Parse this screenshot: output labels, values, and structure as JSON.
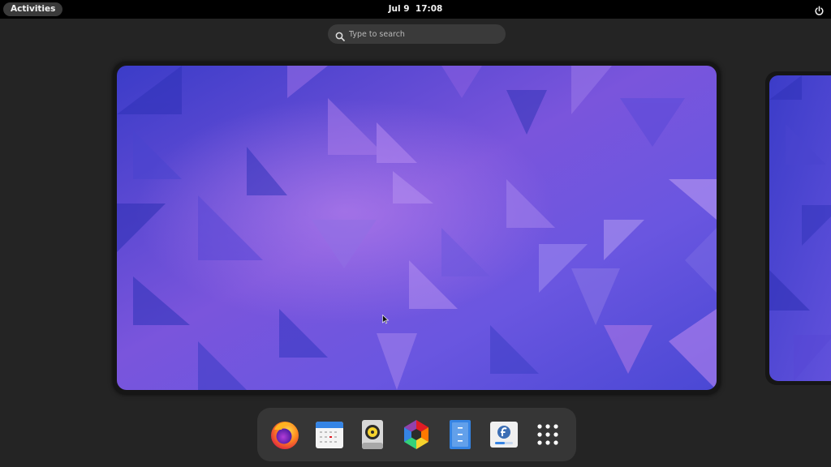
{
  "topbar": {
    "activities_label": "Activities",
    "date": "Jul 9",
    "time": "17:08",
    "power_icon": "power-icon"
  },
  "search": {
    "placeholder": "Type to search",
    "icon": "search-icon"
  },
  "workspaces": {
    "count_visible": 2,
    "wallpaper_colors": [
      "#3d3bc9",
      "#6b4fd8",
      "#8e5fe0",
      "#b07ae8"
    ]
  },
  "dock": {
    "apps": [
      {
        "name": "Firefox",
        "icon": "firefox-icon"
      },
      {
        "name": "Calendar",
        "icon": "calendar-icon"
      },
      {
        "name": "Rhythmbox",
        "icon": "rhythmbox-icon"
      },
      {
        "name": "Software",
        "icon": "software-icon"
      },
      {
        "name": "Files",
        "icon": "files-icon"
      },
      {
        "name": "Fedora Media Writer",
        "icon": "fedora-media-writer-icon"
      },
      {
        "name": "Show Applications",
        "icon": "app-grid-icon"
      }
    ]
  },
  "colors": {
    "background": "#242424",
    "topbar": "#000000",
    "dock": "#363636",
    "search": "#3a3a3a"
  }
}
